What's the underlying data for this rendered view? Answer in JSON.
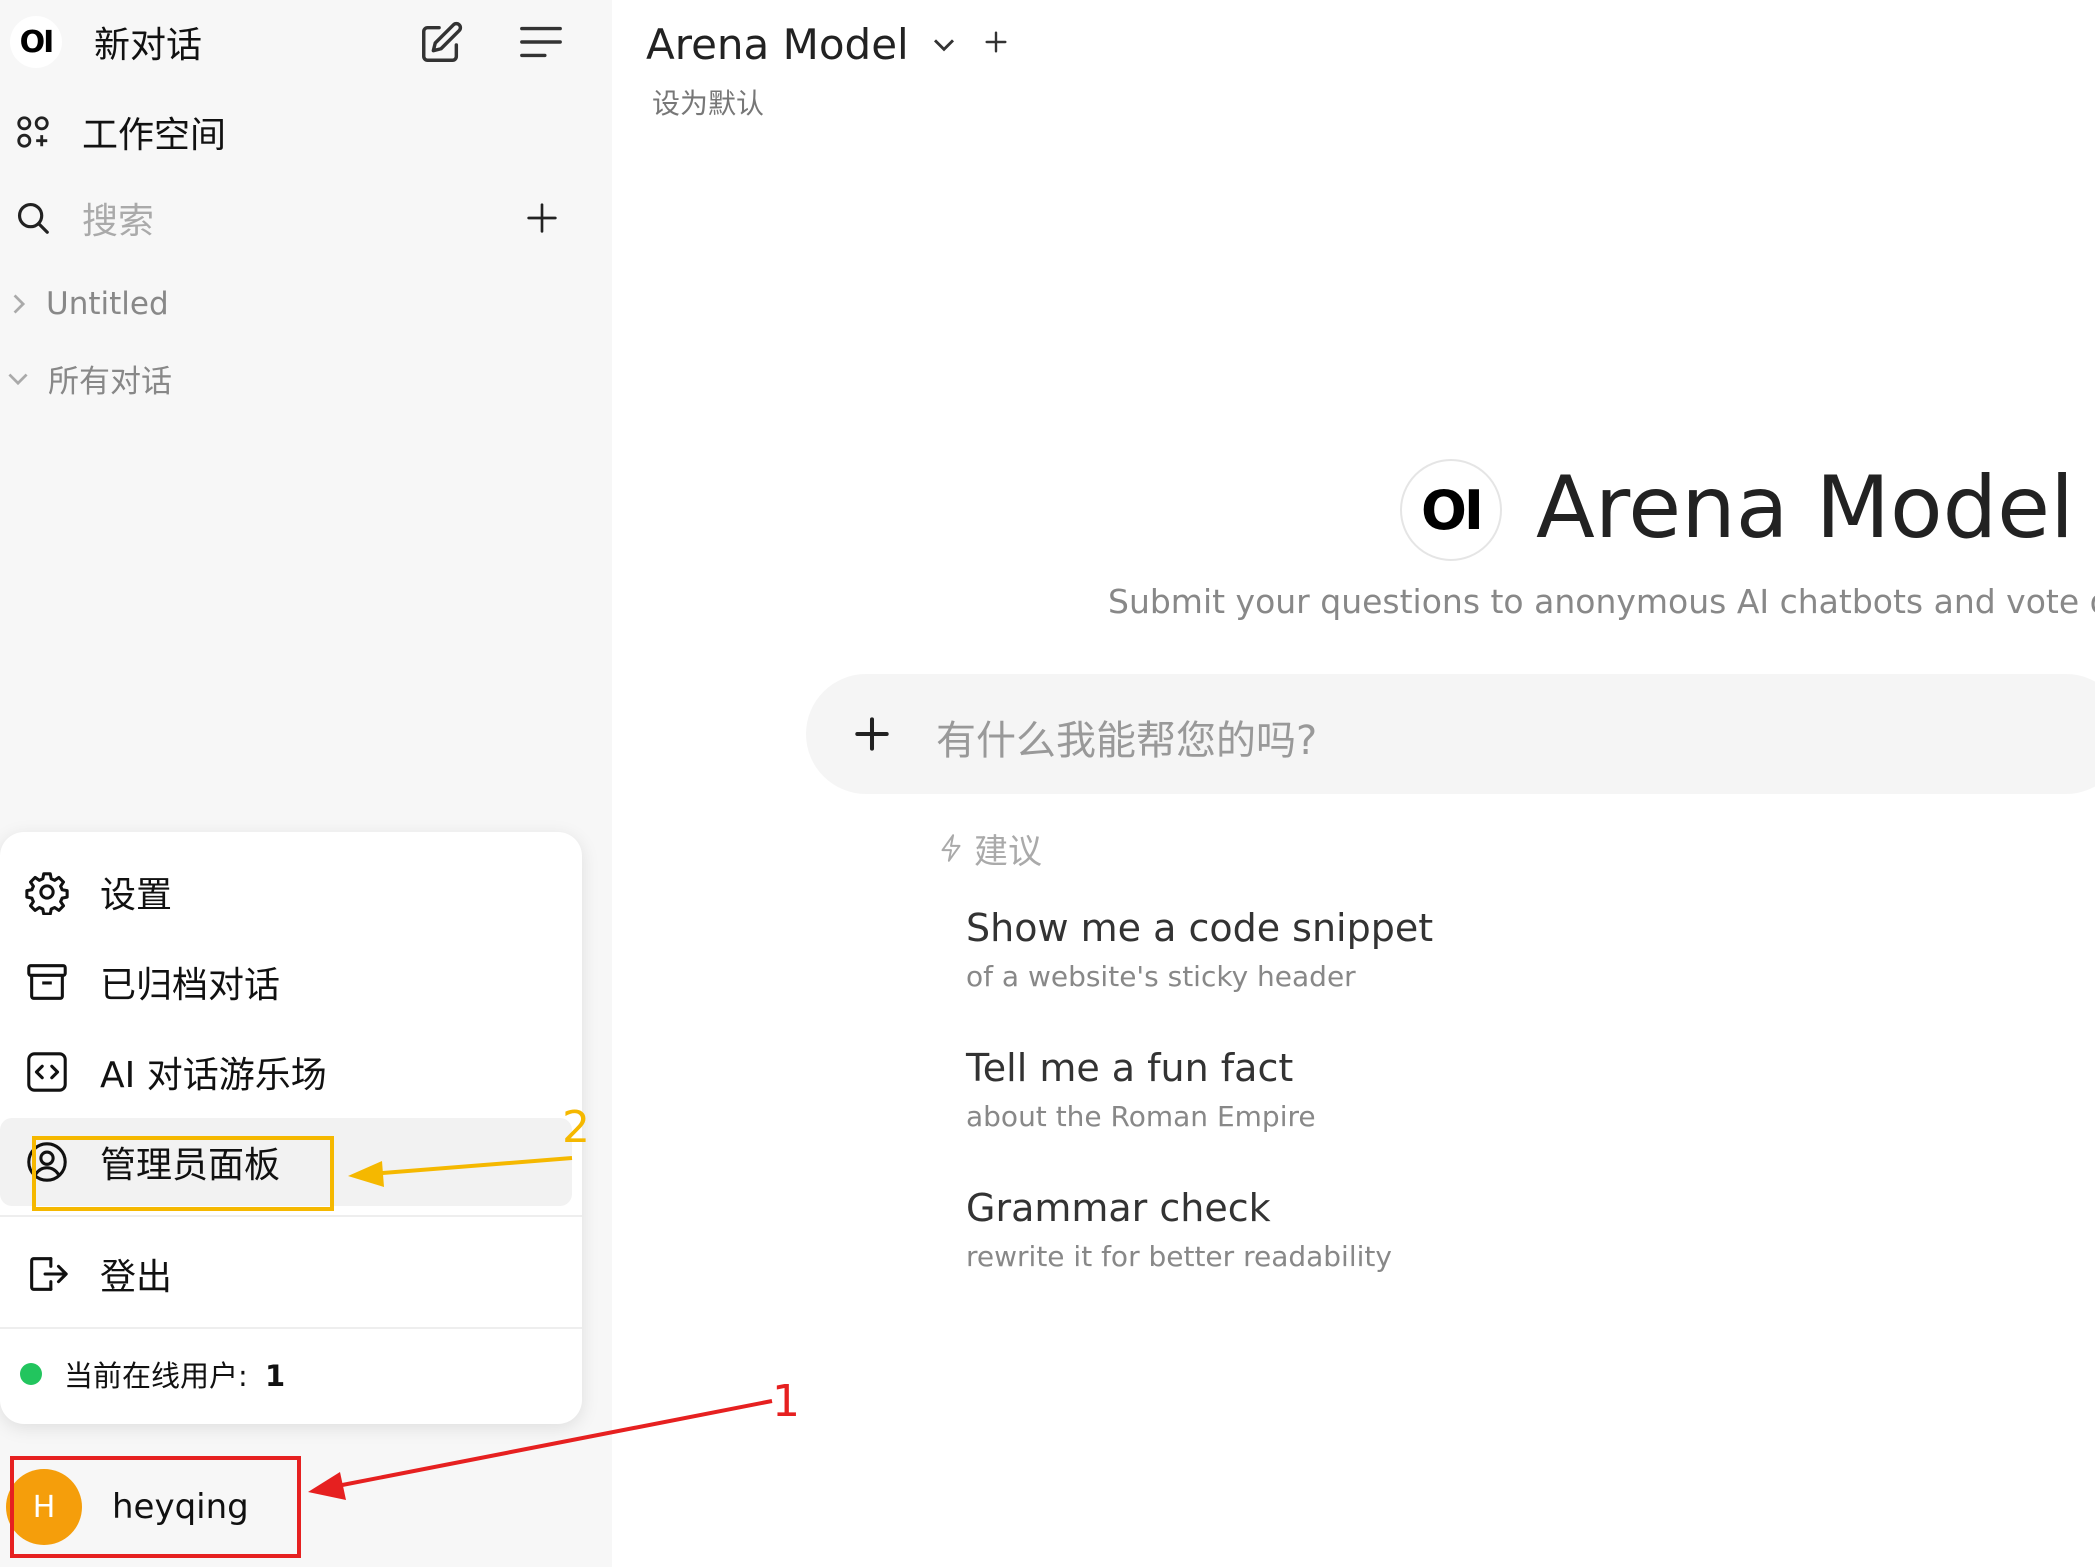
{
  "sidebar": {
    "brand_logo": "OI",
    "new_chat_label": "新对话",
    "workspace_label": "工作空间",
    "search_placeholder": "搜索",
    "folders": [
      {
        "label": "Untitled",
        "expanded": false
      },
      {
        "label": "所有对话",
        "expanded": true
      }
    ]
  },
  "user_menu": {
    "items": [
      {
        "label": "设置",
        "icon": "gear-icon"
      },
      {
        "label": "已归档对话",
        "icon": "archive-icon"
      },
      {
        "label": "AI 对话游乐场",
        "icon": "code-icon"
      },
      {
        "label": "管理员面板",
        "icon": "user-circle-icon"
      },
      {
        "label": "登出",
        "icon": "logout-icon"
      }
    ],
    "online_label": "当前在线用户:",
    "online_count": "1"
  },
  "user": {
    "initial": "H",
    "name": "heyqing",
    "avatar_color": "#f59e0b"
  },
  "header": {
    "model_name": "Arena Model",
    "set_default_label": "设为默认"
  },
  "main": {
    "logo": "OI",
    "title": "Arena Model",
    "subtitle": "Submit your questions to anonymous AI chatbots and vote on the",
    "input_placeholder": "有什么我能帮您的吗?",
    "suggestions_label": "建议",
    "suggestions": [
      {
        "title": "Show me a code snippet",
        "subtitle": "of a website's sticky header"
      },
      {
        "title": "Tell me a fun fact",
        "subtitle": "about the Roman Empire"
      },
      {
        "title": "Grammar check",
        "subtitle": "rewrite it for better readability"
      }
    ]
  },
  "annotations": {
    "step_1": "1",
    "step_2": "2",
    "color_1": "#e62020",
    "color_2": "#f5b800"
  }
}
